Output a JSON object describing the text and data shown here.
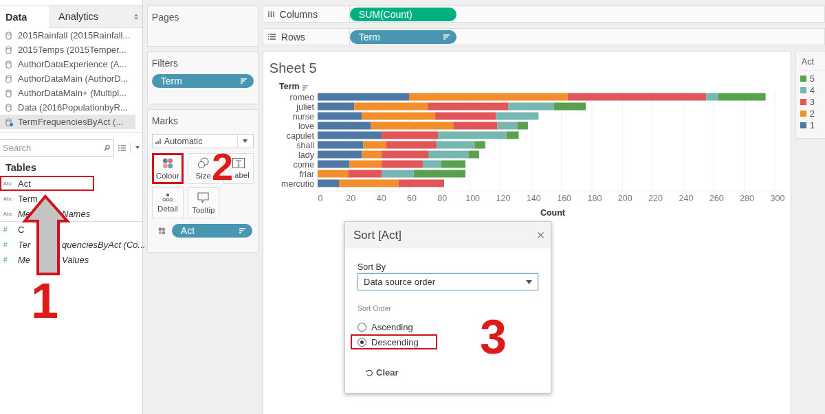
{
  "data_pane": {
    "tabs": [
      {
        "label": "Data",
        "selected": true
      },
      {
        "label": "Analytics",
        "selected": false
      }
    ],
    "sources": [
      {
        "name": "2015Rainfall (2015Rainfall...",
        "kind": "database",
        "selected": false
      },
      {
        "name": "2015Temps (2015Temper...",
        "kind": "database",
        "selected": false
      },
      {
        "name": "AuthorDataExperience (A...",
        "kind": "database",
        "selected": false
      },
      {
        "name": "AuthorDataMain (AuthorD...",
        "kind": "database",
        "selected": false
      },
      {
        "name": "AuthorDataMain+ (Multipl...",
        "kind": "database",
        "selected": false
      },
      {
        "name": "Data (2016PopulationbyR...",
        "kind": "database",
        "selected": false
      },
      {
        "name": "TermFrequenciesByAct (...",
        "kind": "extract",
        "selected": true
      }
    ],
    "search": {
      "placeholder": "Search"
    },
    "tables_heading": "Tables",
    "fields": [
      {
        "type_label": "Abc",
        "kind": "dimension",
        "parts": [
          "Act"
        ],
        "generated": false,
        "highlighted": true
      },
      {
        "type_label": "Abc",
        "kind": "dimension",
        "parts": [
          "Term"
        ],
        "generated": false,
        "highlighted": false
      },
      {
        "type_label": "Abc",
        "kind": "dimension",
        "parts": [
          "Me",
          "Names"
        ],
        "generated": true,
        "highlighted": false
      },
      {
        "type_label": "#",
        "kind": "measure",
        "parts": [
          "C"
        ],
        "generated": false,
        "highlighted": false
      },
      {
        "type_label": "#",
        "kind": "measure",
        "parts": [
          "Ter",
          "quenciesByAct (Co..."
        ],
        "generated": true,
        "highlighted": false
      },
      {
        "type_label": "#",
        "kind": "measure",
        "parts": [
          "Me",
          "Values"
        ],
        "generated": true,
        "highlighted": false
      }
    ]
  },
  "cards": {
    "pages": {
      "title": "Pages"
    },
    "filters": {
      "title": "Filters",
      "pills": [
        {
          "label": "Term",
          "kind": "dimension",
          "sorted": true
        }
      ]
    },
    "marks": {
      "title": "Marks",
      "mark_type": "Automatic",
      "buttons": [
        {
          "label": "Colour",
          "kind": "color",
          "highlighted": true
        },
        {
          "label": "Size",
          "kind": "size",
          "highlighted": false
        },
        {
          "label": "abel",
          "kind": "label",
          "highlighted": false
        },
        {
          "label": "Detail",
          "kind": "detail",
          "highlighted": false
        },
        {
          "label": "Tooltip",
          "kind": "tooltip",
          "highlighted": false
        }
      ],
      "pills": [
        {
          "label": "Act",
          "kind": "dimension",
          "color_encoded": true,
          "sorted": true
        }
      ]
    }
  },
  "shelves": [
    {
      "label": "Columns",
      "kind": "columns",
      "pill": {
        "label": "SUM(Count)",
        "kind": "measure",
        "sorted": false
      }
    },
    {
      "label": "Rows",
      "kind": "rows",
      "pill": {
        "label": "Term",
        "kind": "dimension",
        "sorted": true
      }
    }
  ],
  "sheet": {
    "title": "Sheet 5",
    "chart_data": {
      "type": "bar",
      "orientation": "horizontal",
      "stacked": true,
      "grid": true,
      "xlabel": "Count",
      "ylabel": "Term",
      "categories": [
        "romeo",
        "juliet",
        "nurse",
        "love",
        "capulet",
        "shall",
        "lady",
        "come",
        "friar",
        "mercutio"
      ],
      "series": [
        {
          "name": "1",
          "color": "#4e79a7",
          "values": [
            60,
            24,
            29,
            35,
            42,
            30,
            29,
            21,
            0,
            14
          ]
        },
        {
          "name": "2",
          "color": "#f28e2b",
          "values": [
            104,
            48,
            48,
            54,
            0,
            15,
            13,
            21,
            20,
            39
          ]
        },
        {
          "name": "3",
          "color": "#e15759",
          "values": [
            91,
            53,
            40,
            29,
            37,
            33,
            31,
            27,
            22,
            30
          ]
        },
        {
          "name": "4",
          "color": "#76b7b2",
          "values": [
            8,
            30,
            28,
            13,
            45,
            25,
            26,
            12,
            21,
            0
          ]
        },
        {
          "name": "5",
          "color": "#59a14f",
          "values": [
            31,
            21,
            0,
            7,
            8,
            7,
            7,
            16,
            34,
            0
          ]
        }
      ],
      "xlim": [
        0,
        305
      ],
      "xticks": [
        0,
        20,
        40,
        60,
        80,
        100,
        120,
        140,
        160,
        180,
        200,
        220,
        240,
        260,
        280,
        300
      ]
    },
    "legend": {
      "title": "Act"
    }
  },
  "dialog": {
    "title": "Sort [Act]",
    "sort_by_label": "Sort By",
    "sort_by_value": "Data source order",
    "sort_order_label": "Sort Order",
    "options": [
      {
        "label": "Ascending",
        "selected": false,
        "highlighted": false
      },
      {
        "label": "Descending",
        "selected": true,
        "highlighted": true
      }
    ],
    "clear_label": "Clear"
  },
  "annotations": [
    {
      "kind": "arrow"
    },
    {
      "kind": "callout",
      "text": "1"
    },
    {
      "kind": "callout",
      "text": "2"
    },
    {
      "kind": "callout",
      "text": "3"
    }
  ]
}
